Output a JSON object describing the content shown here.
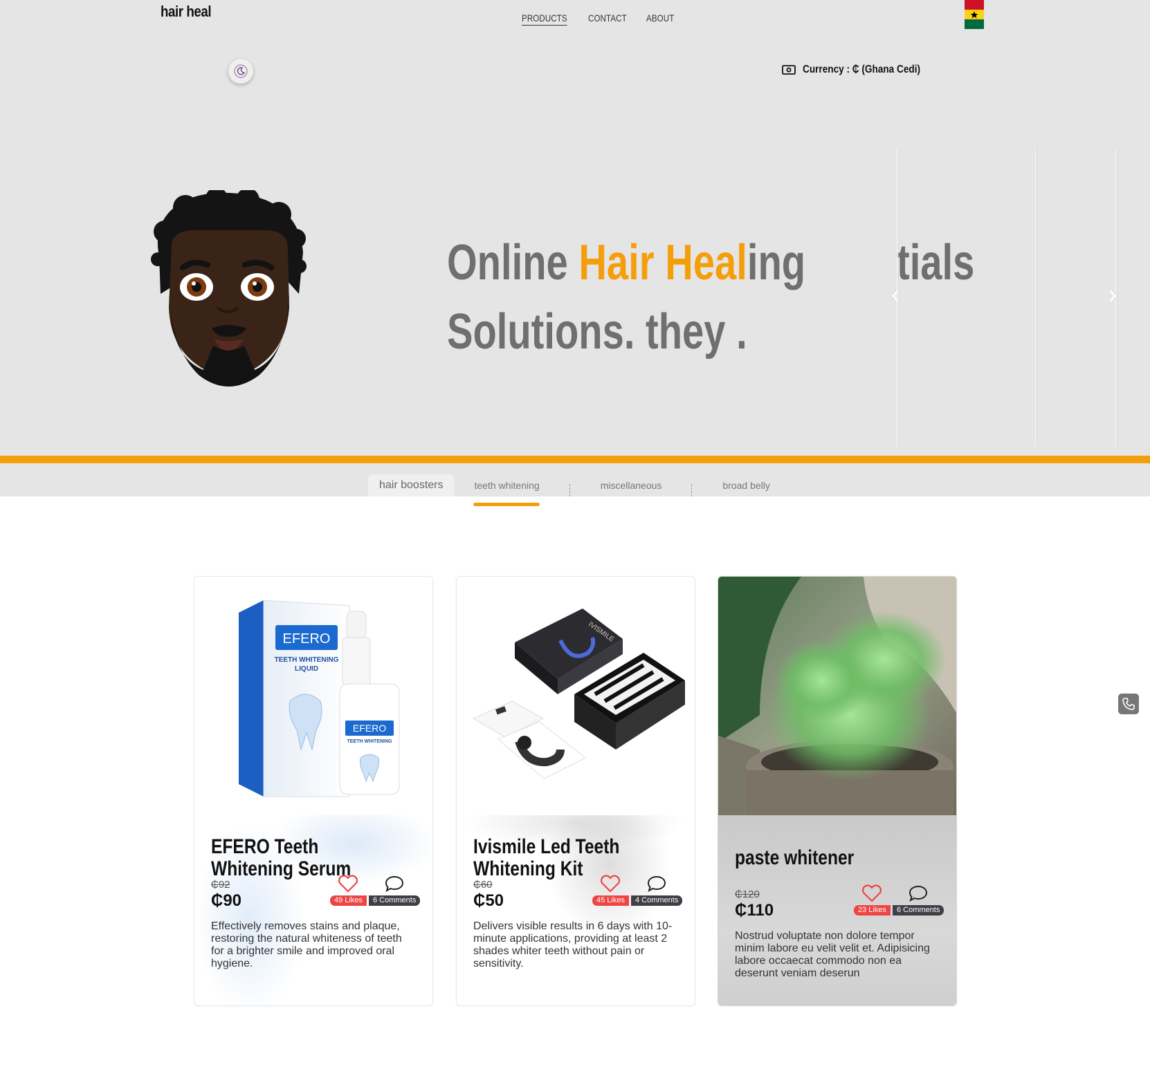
{
  "brand": "hair heal",
  "nav": {
    "products": "PRODUCTS",
    "contact": "CONTACT",
    "about": "ABOUT"
  },
  "currency": {
    "label": "Currency : ₵ (Ghana Cedi)"
  },
  "hero": {
    "line1_pre": "Online ",
    "line1_hl1": "Hair Hea",
    "line1_hl2": "l",
    "line1_post": "ing",
    "line2": "Solutions. they .",
    "peek": "tials"
  },
  "tabs": [
    "hair boosters",
    "teeth whitening",
    "miscellaneous",
    "broad belly"
  ],
  "active_tab": "teeth whitening",
  "products": [
    {
      "title": "EFERO Teeth Whitening Serum",
      "old_price": "₵92",
      "price": "₵90",
      "likes": "49 Likes",
      "comments": "6 Comments",
      "description": "Effectively removes stains and plaque, restoring the natural whiteness of teeth for a brighter smile and improved oral hygiene."
    },
    {
      "title": "Ivismile Led Teeth Whitening Kit",
      "old_price": "₵60",
      "price": "₵50",
      "likes": "45 Likes",
      "comments": "4 Comments",
      "description": "Delivers visible results in 6 days with 10-minute applications, providing at least 2 shades whiter teeth without pain or sensitivity."
    },
    {
      "title": "paste whitener",
      "old_price": "₵120",
      "price": "₵110",
      "likes": "23 Likes",
      "comments": "6 Comments",
      "description": "Nostrud voluptate non dolore tempor minim labore eu velit velit et. Adipisicing labore occaecat commodo non ea deserunt veniam deserun"
    }
  ],
  "colors": {
    "accent": "#f59e0b",
    "hero_bg": "#e6e5e5",
    "likes": "#ef4444",
    "comments": "#3f3f46"
  },
  "icons": [
    "moon-icon",
    "cash-icon",
    "ghana-flag-icon",
    "heart-icon",
    "comment-icon",
    "phone-icon",
    "chevron-left-icon",
    "chevron-right-icon"
  ]
}
